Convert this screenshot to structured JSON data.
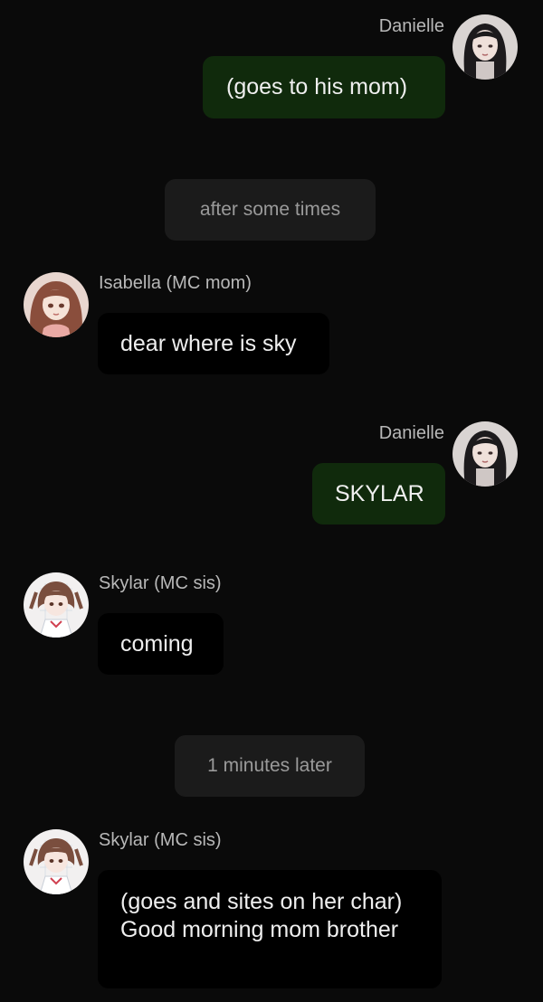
{
  "chat": {
    "messages": [
      {
        "author": "Danielle",
        "text": "(goes to his mom)",
        "side": "out",
        "avatar": "danielle-avatar"
      },
      {
        "system": "after some times"
      },
      {
        "author": "Isabella (MC mom)",
        "text": "dear where is sky",
        "side": "in",
        "avatar": "isabella-avatar"
      },
      {
        "author": "Danielle",
        "text": "SKYLAR",
        "side": "out",
        "avatar": "danielle-avatar"
      },
      {
        "author": "Skylar (MC sis)",
        "text": "coming",
        "side": "in",
        "avatar": "skylar-avatar"
      },
      {
        "system": "1 minutes later"
      },
      {
        "author": "Skylar (MC sis)",
        "text": "(goes and sites on her char) Good morning mom brother",
        "side": "in",
        "avatar": "skylar-avatar"
      }
    ]
  },
  "colors": {
    "background": "#0a0a0a",
    "outgoing_bubble": "#102a0c",
    "incoming_bubble": "#000000",
    "system_pill": "#1b1b1b"
  }
}
